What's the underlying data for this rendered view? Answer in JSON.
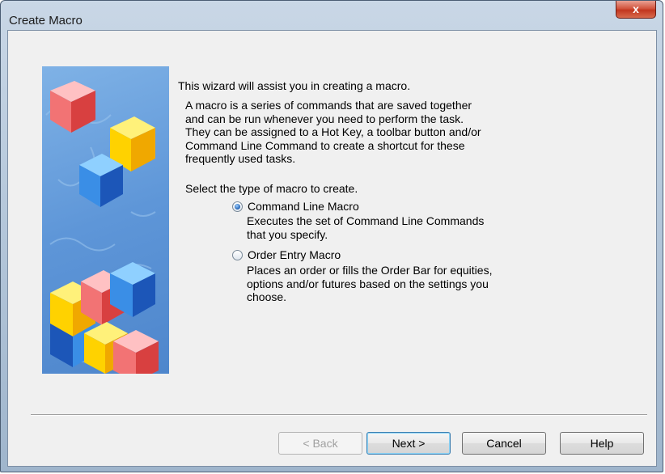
{
  "window": {
    "title": "Create Macro",
    "close_glyph": "x"
  },
  "intro": "This wizard will assist you in creating a macro.",
  "description": [
    "A macro is a series of commands that are saved together",
    "and can be run whenever you need to perform the task.",
    "They can be assigned to a Hot Key, a toolbar button and/or",
    "Command Line Command to create a shortcut for these",
    "frequently used tasks."
  ],
  "select_label": "Select the type of macro to create.",
  "options": [
    {
      "label": "Command Line Macro",
      "selected": true,
      "description": [
        "Executes the set of Command Line Commands",
        "that you specify."
      ]
    },
    {
      "label": "Order Entry Macro",
      "selected": false,
      "description": [
        "Places an order or fills the Order Bar for equities,",
        "options and/or futures based on the settings you",
        "choose."
      ]
    }
  ],
  "buttons": {
    "back": "< Back",
    "next": "Next >",
    "cancel": "Cancel",
    "help": "Help"
  },
  "image": {
    "icon": "stacked-cubes-wizard-image"
  }
}
